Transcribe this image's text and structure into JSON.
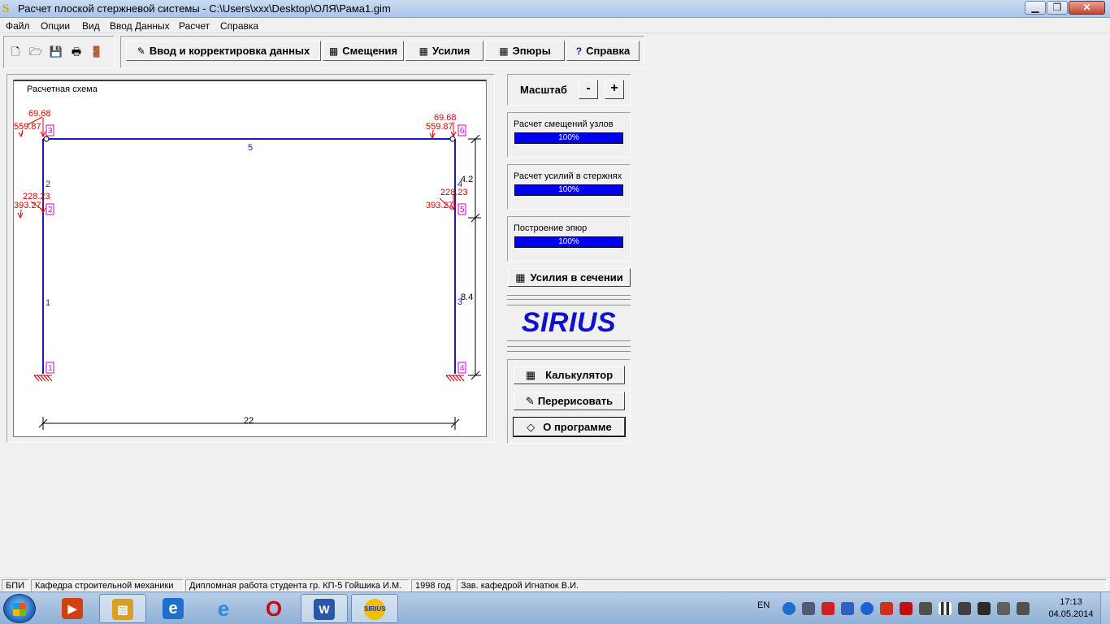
{
  "window": {
    "title": "Расчет плоской стержневой системы - C:\\Users\\xxx\\Desktop\\ОЛЯ\\Рама1.gim",
    "min_glyph": "▁",
    "max_glyph": "❐",
    "close_glyph": "✕"
  },
  "menu": [
    "Файл",
    "Опции",
    "Вид",
    "Ввод Данных",
    "Расчет",
    "Справка"
  ],
  "toolbar": {
    "file_icons": [
      {
        "name": "new-file-icon",
        "glyph": "🗋"
      },
      {
        "name": "open-folder-icon",
        "glyph": "🗁"
      },
      {
        "name": "save-disk-icon",
        "glyph": "💾"
      },
      {
        "name": "print-icon",
        "glyph": "🖶"
      },
      {
        "name": "exit-door-icon",
        "glyph": "🚪"
      }
    ],
    "input_data": "Ввод и корректировка данных",
    "displacements": "Смещения",
    "forces": "Усилия",
    "diagrams": "Эпюры",
    "help": "Справка",
    "calc_glyph": "▦",
    "edit_glyph": "✎",
    "help_glyph": "?"
  },
  "scheme": {
    "title": "Расчетная схема",
    "members": [
      "1",
      "2",
      "3",
      "4",
      "5"
    ],
    "nodes": [
      "1",
      "2",
      "3",
      "4",
      "5",
      "6"
    ],
    "dims": {
      "span": "22",
      "upper_height": "4.2",
      "lower_height": "8.4"
    },
    "loads": {
      "n3_vertical": "69.68",
      "n3_horizontal": "559.87",
      "n6_vertical": "69.68",
      "n6_horizontal": "559.87",
      "n2_vertical": "228.23",
      "n2_horizontal": "393.27",
      "n5_vertical": "228.23",
      "n5_horizontal": "393.27"
    },
    "colors": {
      "frame": "#1a1ab4",
      "load": "#e00000",
      "node": "#d000d0",
      "dim": "#000000"
    }
  },
  "right_panel": {
    "scale_label": "Масштаб",
    "minus": "-",
    "plus": "+",
    "progress": [
      {
        "label": "Расчет смещений узлов",
        "value_text": "100%",
        "value": 100
      },
      {
        "label": "Расчет усилий в стержнях",
        "value_text": "100%",
        "value": 100
      },
      {
        "label": "Построение эпюр",
        "value_text": "100%",
        "value": 100
      }
    ],
    "section_forces": "Усилия в сечении",
    "logo": "SIRIUS",
    "calculator": "Калькулятор",
    "redraw": "Перерисовать",
    "about": "О программе"
  },
  "statusbar": [
    "БПИ",
    "Кафедра строительной механики",
    "Дипломная работа студента гр. КП-5 Гойшика И.М.",
    "1998 год",
    "Зав. кафедрой Игнатюк В.И."
  ],
  "taskbar": {
    "apps": [
      {
        "name": "media-player-icon",
        "glyph": "▶",
        "color": "#d04010"
      },
      {
        "name": "file-explorer-icon",
        "glyph": "▤",
        "color": "#d8a020"
      },
      {
        "name": "ie-metro-icon",
        "glyph": "e",
        "color": "#1e6fd0"
      },
      {
        "name": "internet-explorer-icon",
        "glyph": "e",
        "color": "#2a8be0"
      },
      {
        "name": "opera-icon",
        "glyph": "O",
        "color": "#d00010"
      },
      {
        "name": "word-icon",
        "glyph": "W",
        "color": "#2a56a8"
      },
      {
        "name": "sirius-app-icon",
        "glyph": "SIRIUS",
        "color": "#2030a0"
      }
    ],
    "lang": "EN",
    "time": "17:13",
    "date": "04.05.2014"
  }
}
